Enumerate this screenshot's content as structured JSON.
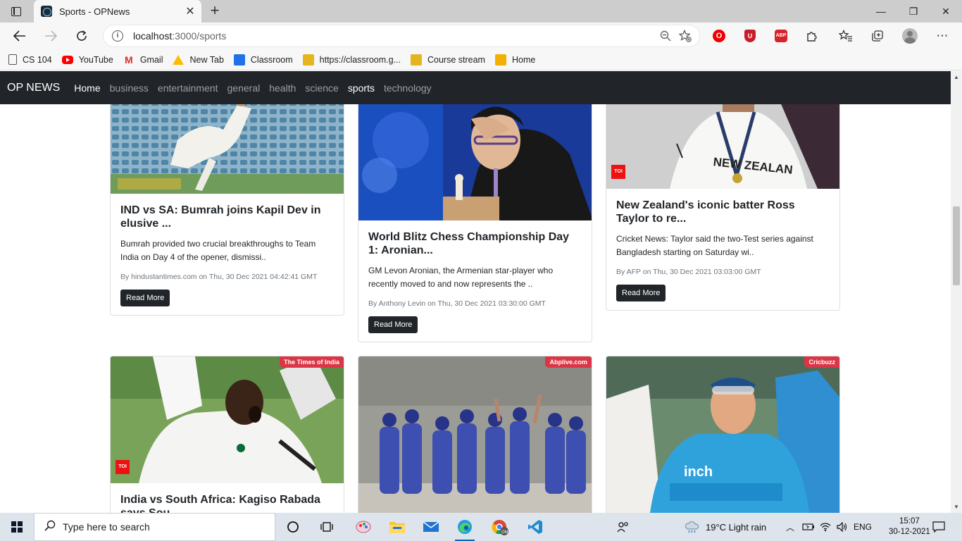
{
  "browser": {
    "tab_title": "Sports - OPNews",
    "tab_close": "✕",
    "new_tab": "+",
    "url_host": "localhost",
    "url_rest": ":3000/sports",
    "minimize": "—",
    "restore": "❐",
    "close": "✕"
  },
  "bookmarks": [
    {
      "label": "CS 104"
    },
    {
      "label": "YouTube"
    },
    {
      "label": "Gmail"
    },
    {
      "label": "New Tab"
    },
    {
      "label": "Classroom"
    },
    {
      "label": "https://classroom.g..."
    },
    {
      "label": "Course stream"
    },
    {
      "label": "Home"
    }
  ],
  "nav": {
    "brand": "OP NEWS",
    "links": [
      "Home",
      "business",
      "entertainment",
      "general",
      "health",
      "science",
      "sports",
      "technology"
    ],
    "active": "sports"
  },
  "cards": [
    {
      "title": "IND vs SA: Bumrah joins Kapil Dev in elusive ...",
      "description": "Bumrah provided two crucial breakthroughs to Team India on Day 4 of the opener, dismissi..",
      "meta": "By hindustantimes.com on Thu, 30 Dec 2021 04:42:41 GMT",
      "button": "Read More"
    },
    {
      "title": "World Blitz Chess Championship Day 1: Aronian...",
      "description": "GM Levon Aronian, the Armenian star-player who recently moved to and now represents the ..",
      "meta": "By Anthony Levin on Thu, 30 Dec 2021 03:30:00 GMT",
      "button": "Read More"
    },
    {
      "title": "New Zealand's iconic batter Ross Taylor to re...",
      "description": "Cricket News: Taylor said the two-Test series against Bangladesh starting on Saturday wi..",
      "meta": "By AFP on Thu, 30 Dec 2021 03:03:00 GMT",
      "button": "Read More",
      "toi": "TOI"
    },
    {
      "badge": "The Times of India",
      "title": "India vs South Africa: Kagiso Rabada says Sou...",
      "toi": "TOI"
    },
    {
      "badge": "Abplive.com"
    },
    {
      "badge": "Cricbuzz"
    }
  ],
  "taskbar": {
    "search_placeholder": "Type here to search",
    "weather": "19°C  Light rain",
    "language": "ENG",
    "time": "15:07",
    "date": "30-12-2021"
  },
  "colors": {
    "navbar": "#212529",
    "badge": "#dc3545",
    "button": "#212529"
  }
}
